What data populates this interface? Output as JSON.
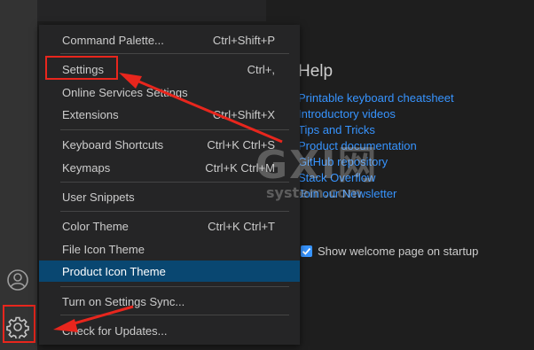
{
  "activity": {
    "accounts_icon": "account-icon",
    "manage_icon": "gear-icon"
  },
  "menu": {
    "items": [
      {
        "label": "Command Palette...",
        "shortcut": "Ctrl+Shift+P"
      },
      {
        "label": "Settings",
        "shortcut": "Ctrl+,"
      },
      {
        "label": "Online Services Settings",
        "shortcut": ""
      },
      {
        "label": "Extensions",
        "shortcut": "Ctrl+Shift+X"
      },
      {
        "label": "Keyboard Shortcuts",
        "shortcut": "Ctrl+K Ctrl+S"
      },
      {
        "label": "Keymaps",
        "shortcut": "Ctrl+K Ctrl+M"
      },
      {
        "label": "User Snippets",
        "shortcut": ""
      },
      {
        "label": "Color Theme",
        "shortcut": "Ctrl+K Ctrl+T"
      },
      {
        "label": "File Icon Theme",
        "shortcut": ""
      },
      {
        "label": "Product Icon Theme",
        "shortcut": ""
      },
      {
        "label": "Turn on Settings Sync...",
        "shortcut": ""
      },
      {
        "label": "Check for Updates...",
        "shortcut": ""
      }
    ]
  },
  "welcome": {
    "help_title": "Help",
    "links": [
      "Printable keyboard cheatsheet",
      "Introductory videos",
      "Tips and Tricks",
      "Product documentation",
      "GitHub repository",
      "Stack Overflow",
      "Join our Newsletter"
    ],
    "startup_checkbox_label": "Show welcome page on startup",
    "startup_checked": true
  },
  "watermark": {
    "line1": "GXI网",
    "line2": "system.com"
  },
  "colors": {
    "accent": "#3794ff",
    "highlight": "#094771",
    "annotation": "#e8261d"
  }
}
